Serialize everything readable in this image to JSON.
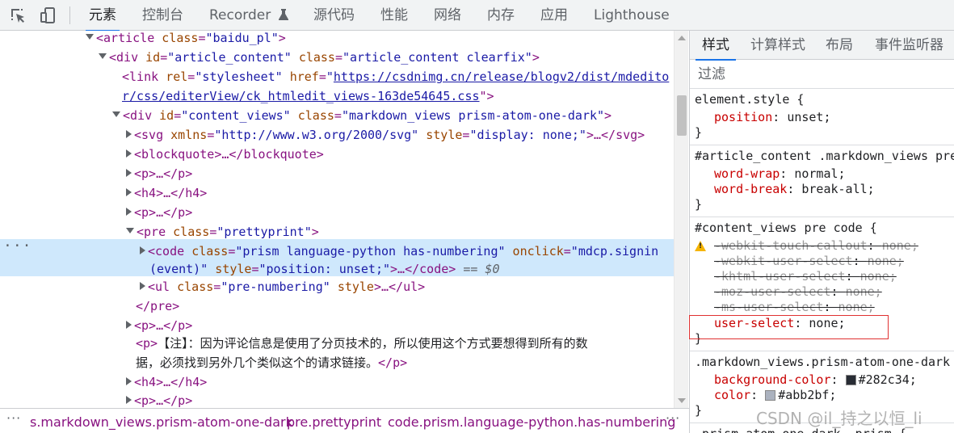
{
  "toolbar": {
    "tabs": [
      {
        "label": "元素",
        "active": true
      },
      {
        "label": "控制台"
      },
      {
        "label": "Recorder"
      },
      {
        "label": "源代码"
      },
      {
        "label": "性能"
      },
      {
        "label": "网络"
      },
      {
        "label": "内存"
      },
      {
        "label": "应用"
      },
      {
        "label": "Lighthouse"
      }
    ]
  },
  "tree": {
    "dom_eq": "== $0",
    "more_dots": "···",
    "lines": {
      "article_open": {
        "tag": "<article",
        "attr": "class",
        "val": "\"baidu_pl\"",
        "close": ">"
      },
      "div_content": {
        "tag": "<div",
        "attr1": "id",
        "val1": "\"article_content\"",
        "attr2": "class",
        "val2": "\"article_content clearfix\"",
        "close": ">"
      },
      "link": {
        "tag": "<link",
        "attr1": "rel",
        "val1": "\"stylesheet\"",
        "attr2": "href",
        "q": "\"",
        "href1": "https://csdnimg.cn/release/blogv2/dist/mdedito",
        "href2": "r/css/editerView/ck_htmledit_views-163de54645.css",
        "close": "\">"
      },
      "div_views": {
        "tag": "<div",
        "attr1": "id",
        "val1": "\"content_views\"",
        "attr2": "class",
        "val2": "\"markdown_views prism-atom-one-dark\"",
        "close": ">"
      },
      "svg": {
        "tag": "<svg",
        "attr1": "xmlns",
        "val1": "\"http://www.w3.org/2000/svg\"",
        "attr2": "style",
        "val2": "\"display: none;\"",
        "mid": ">…</",
        "end": "svg>"
      },
      "blockquote": {
        "text": "<blockquote>…</blockquote>"
      },
      "p1": {
        "text": "<p>…</p>"
      },
      "h4_1": {
        "text": "<h4>…</h4>"
      },
      "p2": {
        "text": "<p>…</p>"
      },
      "pre": {
        "tag": "<pre",
        "attr": "class",
        "val": "\"prettyprint\"",
        "close": ">"
      },
      "code": {
        "tag": "<code",
        "attr1": "class",
        "val1": "\"prism language-python has-numbering\"",
        "attr2": "onclick",
        "val2a": "\"mdcp.signin",
        "val2b": "(event)\"",
        "attr3": "style",
        "val3": "\"position: unset;\"",
        "mid": ">…</code>"
      },
      "ul": {
        "tag": "<ul",
        "attr1": "class",
        "val1": "\"pre-numbering\"",
        "attr2": "style",
        "mid": ">…</ul>"
      },
      "pre_close": {
        "text": "</pre>"
      },
      "p3": {
        "text": "<p>…</p>"
      },
      "p_note": {
        "open": "<p>",
        "text1": "【注】：因为评论信息是使用了分页技术的，所以使用这个方式要想得到所有的数",
        "text2": "据，必须找到另外几个类似这个的请求链接。",
        "close": "</p>"
      },
      "h4_2": {
        "text": "<h4>…</h4>"
      },
      "p4": {
        "text": "<p>…</p>"
      }
    }
  },
  "breadcrumbs": {
    "dots": "…",
    "items": [
      "s.markdown_views.prism-atom-one-dark",
      "pre.prettyprint",
      "code.prism.language-python.has-numbering"
    ],
    "more": "···"
  },
  "styles_panel": {
    "tabs": [
      {
        "label": "样式",
        "active": true
      },
      {
        "label": "计算样式"
      },
      {
        "label": "布局"
      },
      {
        "label": "事件监听器"
      }
    ],
    "filter_placeholder": "过滤",
    "rules": [
      {
        "selector": "element.style {",
        "props": [
          {
            "name": "position",
            "value": "unset;"
          }
        ],
        "end": "}"
      },
      {
        "selector": "#article_content .markdown_views pre",
        "props": [
          {
            "name": "word-wrap",
            "value": "normal;"
          },
          {
            "name": "word-break",
            "value": "break-all;"
          }
        ],
        "end": "}"
      },
      {
        "selector": "#content_views pre code {",
        "props": [
          {
            "name": "-webkit-touch-callout",
            "value": "none;",
            "struck": true,
            "warning": true
          },
          {
            "name": "-webkit-user-select",
            "value": "none;",
            "struck": true
          },
          {
            "name": "-khtml-user-select",
            "value": "none;",
            "struck": true
          },
          {
            "name": "-moz-user-select",
            "value": "none;",
            "struck": true
          },
          {
            "name": "-ms-user-select",
            "value": "none;",
            "struck": true
          },
          {
            "name": "user-select",
            "value": "none;",
            "highlighted": true
          }
        ],
        "end": "}"
      },
      {
        "selector": ".markdown_views.prism-atom-one-dark",
        "props": [
          {
            "name": "background-color",
            "value": "#282c34;",
            "swatch": "#282c34"
          },
          {
            "name": "color",
            "value": "#abb2bf;",
            "swatch": "#abb2bf"
          }
        ],
        "end": "}"
      },
      {
        "selector": ".prism-atom-one-dark .prism {",
        "props": []
      }
    ]
  },
  "watermark": "CSDN @il_持之以恒_li",
  "colors": {
    "accent": "#1a73e8",
    "selection": "#cfe8fc",
    "highlight_box": "#e03131",
    "tag": "#881280",
    "attr_name": "#994500",
    "attr_value": "#1a1aa6"
  }
}
